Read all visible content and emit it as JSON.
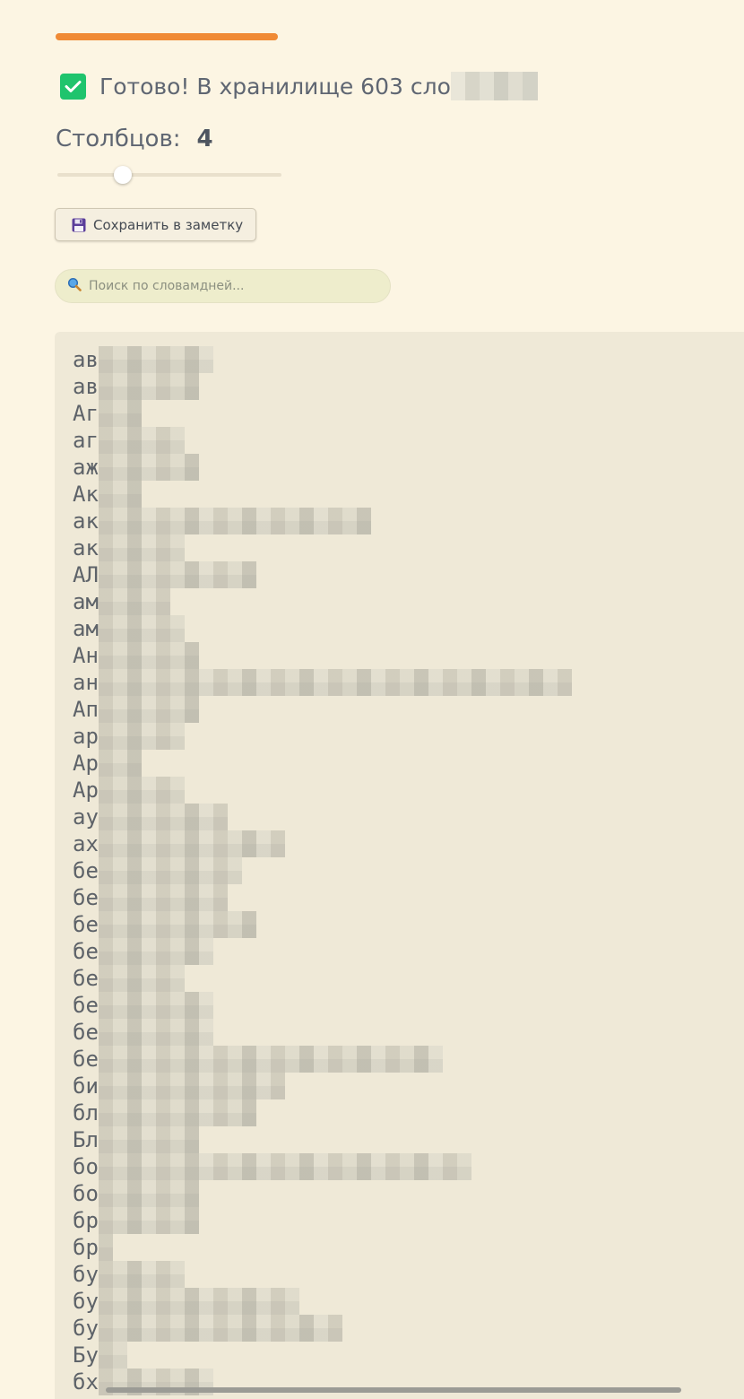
{
  "progress": {
    "value": 1.0,
    "color": "#f08a35"
  },
  "status": {
    "text": "Готово! В хранилище 603 сло",
    "check_icon": "checkbox-checked-icon",
    "check_color": "#1fc46d"
  },
  "columns": {
    "label": "Столбцов:",
    "value": "4",
    "slider_value": 4,
    "slider_min": 1,
    "slider_max": 12
  },
  "save_button": {
    "icon": "floppy-disk-icon",
    "label": "Сохранить в заметку"
  },
  "search": {
    "icon": "magnifier-icon",
    "placeholder": "Поиск по словамдней..."
  },
  "words": [
    "ав",
    "ав",
    "Аг",
    "аг",
    "аж",
    "Ак",
    "ак",
    "ак",
    "АЛ",
    "ам",
    "ам",
    "Ан",
    "ан",
    "Ап",
    "ар",
    "Ар",
    "Ар",
    "ау",
    "ах",
    "бе",
    "бе",
    "бе",
    "бе",
    "бе",
    "бе",
    "бе",
    "бе",
    "би",
    "бл",
    "Бл",
    "бо",
    "бо",
    "бр",
    "бр",
    "бу",
    "бу",
    "бу",
    "Бу",
    "бх"
  ]
}
